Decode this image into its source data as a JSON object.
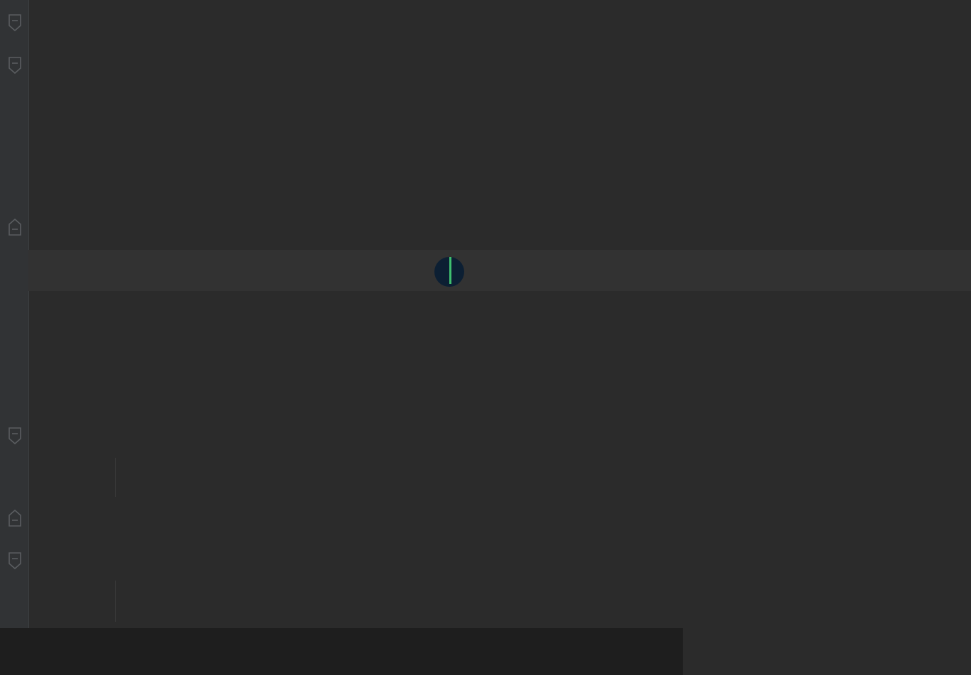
{
  "colors": {
    "background": "#2b2b2b",
    "keyword": "#cc7832",
    "field": "#9876aa",
    "number": "#6897bb",
    "comment": "#808080",
    "text": "#a9b7c6"
  },
  "code": {
    "class_kw": "",
    "class_name": "",
    "class_brace": "",
    "comment_open": "",
    "comment_line1": "",
    "comment_line2": "",
    "comment_line3": "",
    "comment_close": "",
    "kw_public": "",
    "kw_final": "",
    "kw_double": "",
    "field1_a": "",
    "field1_b": "",
    "op_assign": "",
    "val1": "",
    "semicolon": "",
    "field2": "",
    "field2_semi": "",
    "field3": "",
    "field3_semi": "",
    "ctor_kw": "",
    "ctor_name": "",
    "ctor_rest": "",
    "ctor_body_field": "",
    "ctor_body_op": "",
    "ctor_body_val": "",
    "ctor_body_semi": "",
    "close_brace": "",
    "open_brace": "",
    "block_body_field": "",
    "block_body_op": "",
    "block_body_val": "",
    "block_body_semi": ""
  },
  "subtitle": {
    "text": "",
    "badge": ""
  },
  "icons": [
    "fold-icon",
    "cursor-icon",
    "caret-icon"
  ]
}
